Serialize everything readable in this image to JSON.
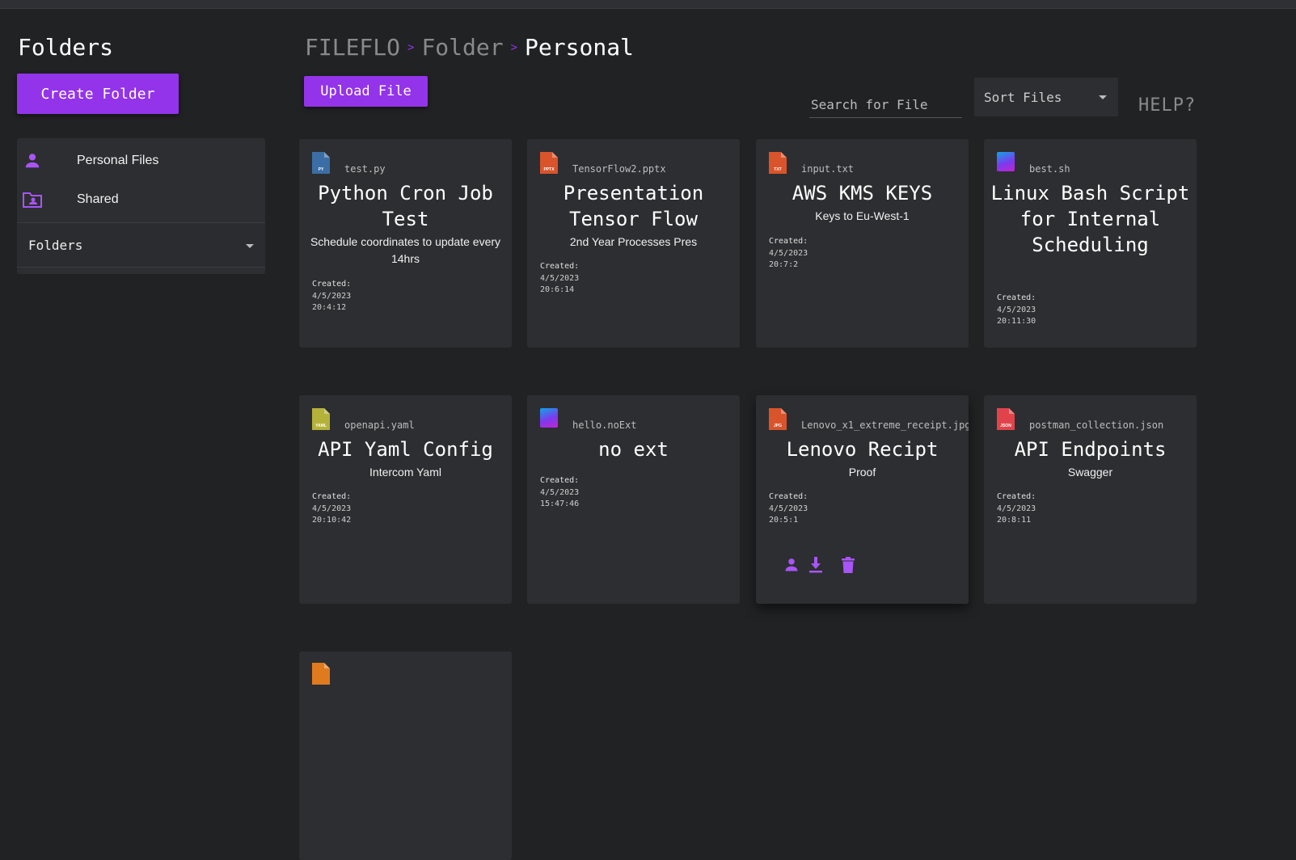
{
  "sidebar": {
    "title": "Folders",
    "create_label": "Create Folder",
    "items": [
      {
        "label": "Personal Files",
        "icon": "person-icon"
      },
      {
        "label": "Shared",
        "icon": "folder-shared-icon"
      }
    ],
    "folders_dropdown": "Folders"
  },
  "header": {
    "breadcrumb": [
      "FILEFLO",
      "Folder",
      "Personal"
    ],
    "separator": ">",
    "upload_label": "Upload File",
    "search_placeholder": "Search for File",
    "sort_label": "Sort Files",
    "help_label": "HELP?"
  },
  "colors": {
    "accent": "#9333ea",
    "bg": "#212224",
    "card": "#2d2e31"
  },
  "created_label": "Created:",
  "files": [
    {
      "filename": "test.py",
      "type": "PY",
      "icon_color": "#3b6ea5",
      "title": "Python Cron Job Test",
      "description": "Schedule coordinates to update every 14hrs",
      "date": "4/5/2023",
      "time": "20:4:12"
    },
    {
      "filename": "TensorFlow2.pptx",
      "type": "PPTX",
      "icon_color": "#d9542b",
      "title": "Presentation Tensor Flow",
      "description": "2nd Year Processes Pres",
      "date": "4/5/2023",
      "time": "20:6:14"
    },
    {
      "filename": "input.txt",
      "type": "TXT",
      "icon_color": "#d9542b",
      "title": "AWS KMS KEYS",
      "description": "Keys to Eu-West-1",
      "date": "4/5/2023",
      "time": "20:7:2"
    },
    {
      "filename": "best.sh",
      "type": "",
      "icon_color": "gradient",
      "title": "Linux Bash Script for Internal Scheduling",
      "description": "",
      "date": "4/5/2023",
      "time": "20:11:30"
    },
    {
      "filename": "openapi.yaml",
      "type": "YAML",
      "icon_color": "#b5b23a",
      "title": "API Yaml Config",
      "description": "Intercom Yaml",
      "date": "4/5/2023",
      "time": "20:10:42"
    },
    {
      "filename": "hello.noExt",
      "type": "",
      "icon_color": "gradient",
      "title": "no ext",
      "description": "",
      "date": "4/5/2023",
      "time": "15:47:46"
    },
    {
      "filename": "Lenovo_x1_extreme_receipt.jpg",
      "type": "JPG",
      "icon_color": "#d9542b",
      "title": "Lenovo Recipt",
      "description": "Proof",
      "date": "4/5/2023",
      "time": "20:5:1"
    },
    {
      "filename": "postman_collection.json",
      "type": "JSON",
      "icon_color": "#e0444a",
      "title": "API Endpoints",
      "description": "Swagger",
      "date": "4/5/2023",
      "time": "20:8:11"
    }
  ],
  "card_actions": [
    "share-icon",
    "download-icon",
    "delete-icon"
  ]
}
